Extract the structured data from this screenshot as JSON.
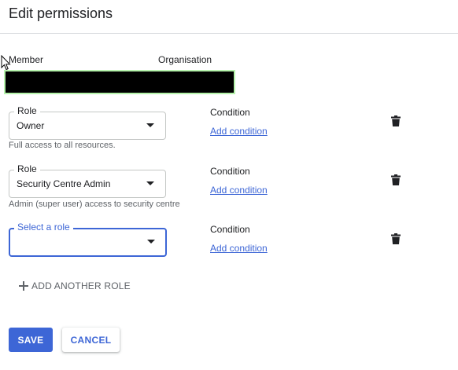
{
  "title": "Edit permissions",
  "member": {
    "label": "Member",
    "org_label": "Organisation",
    "value_redacted": true
  },
  "roles": [
    {
      "label": "Role",
      "value": "Owner",
      "helper": "Full access to all resources.",
      "condition_label": "Condition",
      "condition_link": "Add condition"
    },
    {
      "label": "Role",
      "value": "Security Centre Admin",
      "helper": "Admin (super user) access to security centre",
      "condition_label": "Condition",
      "condition_link": "Add condition"
    },
    {
      "label": "Select a role",
      "value": "",
      "helper": "",
      "condition_label": "Condition",
      "condition_link": "Add condition"
    }
  ],
  "add_role_label": "ADD ANOTHER ROLE",
  "buttons": {
    "save": "SAVE",
    "cancel": "CANCEL"
  },
  "colors": {
    "accent": "#3d66d6",
    "member_highlight": "#b6f3ac"
  }
}
